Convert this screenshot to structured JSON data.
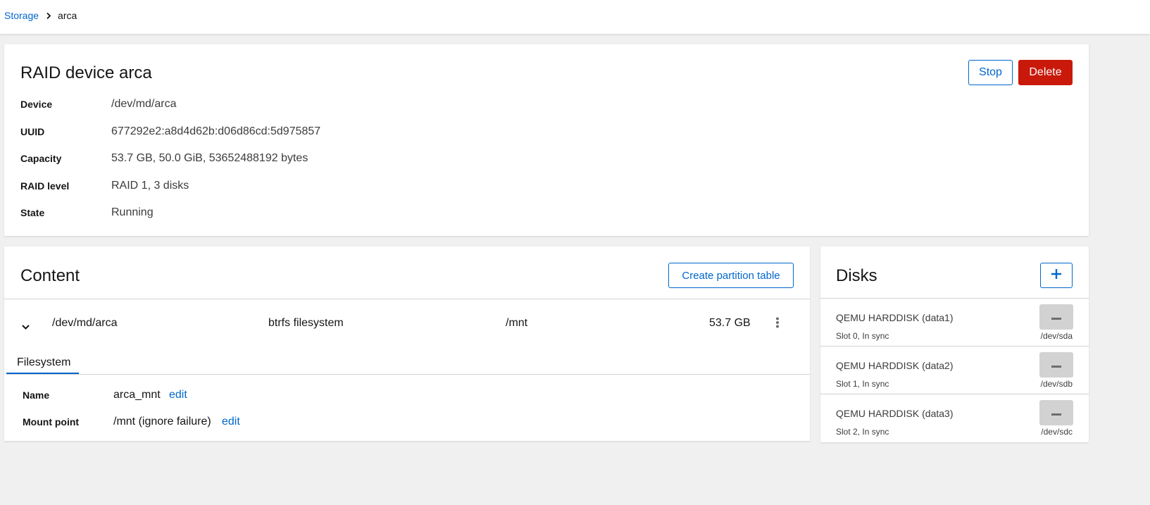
{
  "breadcrumb": {
    "root": "Storage",
    "current": "arca"
  },
  "raid": {
    "title": "RAID device arca",
    "stop_label": "Stop",
    "delete_label": "Delete",
    "fields": [
      {
        "label": "Device",
        "value": "/dev/md/arca"
      },
      {
        "label": "UUID",
        "value": "677292e2:a8d4d62b:d06d86cd:5d975857"
      },
      {
        "label": "Capacity",
        "value": "53.7 GB, 50.0 GiB, 53652488192 bytes"
      },
      {
        "label": "RAID level",
        "value": "RAID 1, 3 disks"
      },
      {
        "label": "State",
        "value": "Running"
      }
    ]
  },
  "content": {
    "title": "Content",
    "create_label": "Create partition table",
    "row": {
      "device": "/dev/md/arca",
      "type": "btrfs filesystem",
      "mount": "/mnt",
      "size": "53.7 GB"
    },
    "tab": "Filesystem",
    "details": {
      "name_label": "Name",
      "name_value": "arca_mnt",
      "name_edit": "edit",
      "mount_label": "Mount point",
      "mount_value": "/mnt (ignore failure)",
      "mount_edit": "edit"
    }
  },
  "disks": {
    "title": "Disks",
    "items": [
      {
        "name": "QEMU HARDDISK (data1)",
        "status": "Slot 0, In sync",
        "device": "/dev/sda"
      },
      {
        "name": "QEMU HARDDISK (data2)",
        "status": "Slot 1, In sync",
        "device": "/dev/sdb"
      },
      {
        "name": "QEMU HARDDISK (data3)",
        "status": "Slot 2, In sync",
        "device": "/dev/sdc"
      }
    ]
  },
  "colors": {
    "link": "#0066cc",
    "danger": "#c9190b",
    "background": "#f0f0f0"
  }
}
